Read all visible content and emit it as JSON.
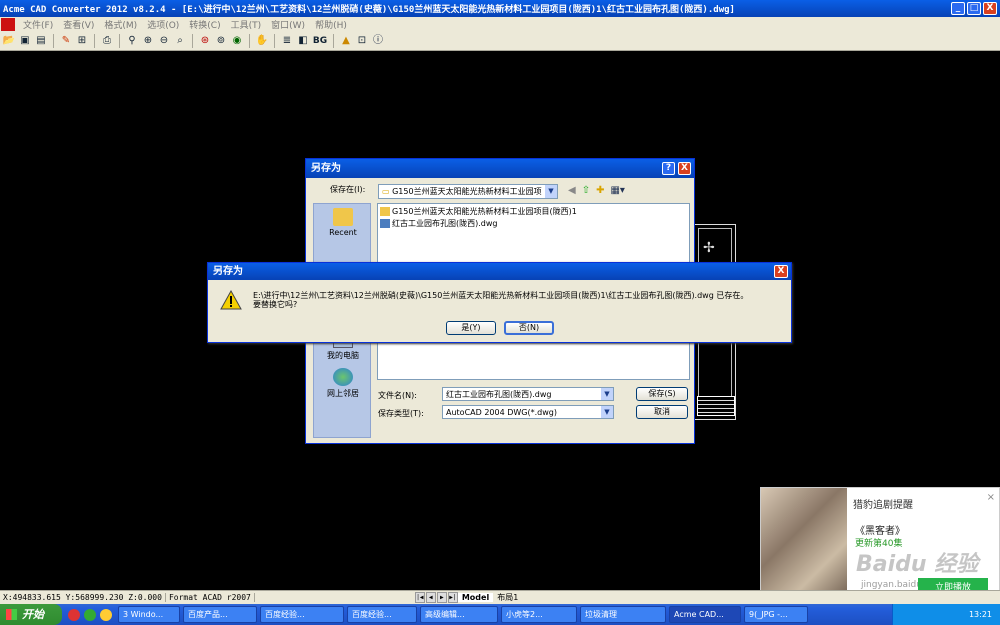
{
  "window": {
    "title": "Acme CAD Converter 2012 v8.2.4 - [E:\\进行中\\12兰州\\工艺资料\\12兰州脱硝(史薇)\\G150兰州蓝天太阳能光热新材料工业园项目(陇西)1\\红古工业园布孔图(陇西).dwg]",
    "minimize": "_",
    "maximize": "□",
    "close": "X"
  },
  "menu": [
    "文件(F)",
    "查看(V)",
    "格式(M)",
    "选项(O)",
    "转换(C)",
    "工具(T)",
    "窗口(W)",
    "帮助(H)"
  ],
  "toolbar": {
    "icons": [
      "open-icon",
      "save-icon",
      "save-all-icon",
      "pen-icon",
      "zoom-window-icon",
      "print-icon",
      "zoom-realtime-icon",
      "zoom-in-icon",
      "zoom-out-icon",
      "zoom-extents-icon",
      "zoom-previous-icon",
      "zoom-all-icon",
      "eye-icon",
      "pan-icon",
      "layers-icon",
      "bw-icon"
    ],
    "bg_label": "BG",
    "info_icon": "info-icon"
  },
  "save_dialog": {
    "title": "另存为",
    "help_btn": "?",
    "close_btn": "X",
    "save_in_label": "保存在(I):",
    "save_in_value": "G150兰州蓝天太阳能光热新材料工业园项",
    "places": [
      {
        "label": "Recent",
        "icon": "recent-folder-icon"
      },
      {
        "label": "我的电脑",
        "icon": "my-computer-icon"
      },
      {
        "label": "网上邻居",
        "icon": "network-icon"
      }
    ],
    "files": [
      {
        "name": "G150兰州蓝天太阳能光热新材料工业园项目(陇西)1",
        "icon": "folder-icon"
      },
      {
        "name": "红古工业园布孔图(陇西).dwg",
        "icon": "dwg-file-icon"
      }
    ],
    "filename_label": "文件名(N):",
    "filename_value": "红古工业园布孔图(陇西).dwg",
    "filetype_label": "保存类型(T):",
    "filetype_value": "AutoCAD 2004 DWG(*.dwg)",
    "save_button": "保存(S)",
    "cancel_button": "取消"
  },
  "confirm_dialog": {
    "title": "另存为",
    "close_btn": "X",
    "message_line1": "E:\\进行中\\12兰州\\工艺资料\\12兰州脱硝(史薇)\\G150兰州蓝天太阳能光热新材料工业园项目(陇西)1\\红古工业园布孔图(陇西).dwg 已存在。",
    "message_line2": "要替换它吗?",
    "yes_button": "是(Y)",
    "no_button": "否(N)"
  },
  "ad_popup": {
    "title": "猎豹追剧提醒",
    "close": "×",
    "show_name": "《黑客者》",
    "episodes": "更新第40集",
    "watermark": "Baidu 经验",
    "watermark_url": "jingyan.baidu.com",
    "later": "以后再说",
    "play_button": "立即播放"
  },
  "status_bar": {
    "coords": "X:494833.615 Y:568999.230 Z:0.000",
    "format": "Format ACAD r2007",
    "tabs": [
      {
        "label": "Model",
        "active": true
      },
      {
        "label": "布局1",
        "active": false
      }
    ]
  },
  "taskbar": {
    "start": "开始",
    "tasks": [
      {
        "label": "3 Windo...",
        "active": false,
        "width": 62
      },
      {
        "label": "百度产品...",
        "active": false,
        "width": 74
      },
      {
        "label": "百度经验...",
        "active": false,
        "width": 84
      },
      {
        "label": "百度经验...",
        "active": false,
        "width": 70
      },
      {
        "label": "高级编辑...",
        "active": false,
        "width": 78
      },
      {
        "label": "小虎等2...",
        "active": false,
        "width": 76
      },
      {
        "label": "垃圾清理",
        "active": false,
        "width": 86
      },
      {
        "label": "Acme CAD...",
        "active": true,
        "width": 72
      },
      {
        "label": "9(_JPG -...",
        "active": false,
        "width": 64
      }
    ],
    "clock": "13:21"
  }
}
